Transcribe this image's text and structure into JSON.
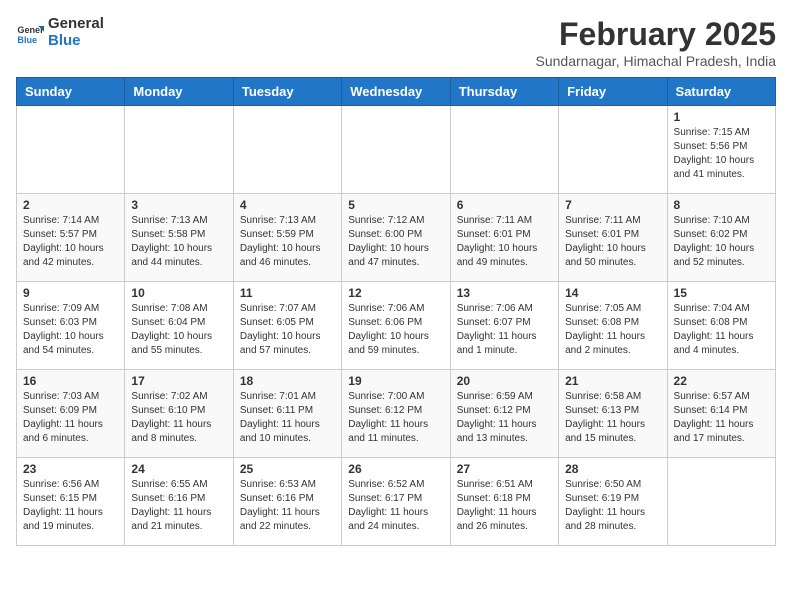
{
  "header": {
    "logo_line1": "General",
    "logo_line2": "Blue",
    "month_year": "February 2025",
    "location": "Sundarnagar, Himachal Pradesh, India"
  },
  "weekdays": [
    "Sunday",
    "Monday",
    "Tuesday",
    "Wednesday",
    "Thursday",
    "Friday",
    "Saturday"
  ],
  "weeks": [
    [
      {
        "day": "",
        "info": ""
      },
      {
        "day": "",
        "info": ""
      },
      {
        "day": "",
        "info": ""
      },
      {
        "day": "",
        "info": ""
      },
      {
        "day": "",
        "info": ""
      },
      {
        "day": "",
        "info": ""
      },
      {
        "day": "1",
        "info": "Sunrise: 7:15 AM\nSunset: 5:56 PM\nDaylight: 10 hours\nand 41 minutes."
      }
    ],
    [
      {
        "day": "2",
        "info": "Sunrise: 7:14 AM\nSunset: 5:57 PM\nDaylight: 10 hours\nand 42 minutes."
      },
      {
        "day": "3",
        "info": "Sunrise: 7:13 AM\nSunset: 5:58 PM\nDaylight: 10 hours\nand 44 minutes."
      },
      {
        "day": "4",
        "info": "Sunrise: 7:13 AM\nSunset: 5:59 PM\nDaylight: 10 hours\nand 46 minutes."
      },
      {
        "day": "5",
        "info": "Sunrise: 7:12 AM\nSunset: 6:00 PM\nDaylight: 10 hours\nand 47 minutes."
      },
      {
        "day": "6",
        "info": "Sunrise: 7:11 AM\nSunset: 6:01 PM\nDaylight: 10 hours\nand 49 minutes."
      },
      {
        "day": "7",
        "info": "Sunrise: 7:11 AM\nSunset: 6:01 PM\nDaylight: 10 hours\nand 50 minutes."
      },
      {
        "day": "8",
        "info": "Sunrise: 7:10 AM\nSunset: 6:02 PM\nDaylight: 10 hours\nand 52 minutes."
      }
    ],
    [
      {
        "day": "9",
        "info": "Sunrise: 7:09 AM\nSunset: 6:03 PM\nDaylight: 10 hours\nand 54 minutes."
      },
      {
        "day": "10",
        "info": "Sunrise: 7:08 AM\nSunset: 6:04 PM\nDaylight: 10 hours\nand 55 minutes."
      },
      {
        "day": "11",
        "info": "Sunrise: 7:07 AM\nSunset: 6:05 PM\nDaylight: 10 hours\nand 57 minutes."
      },
      {
        "day": "12",
        "info": "Sunrise: 7:06 AM\nSunset: 6:06 PM\nDaylight: 10 hours\nand 59 minutes."
      },
      {
        "day": "13",
        "info": "Sunrise: 7:06 AM\nSunset: 6:07 PM\nDaylight: 11 hours\nand 1 minute."
      },
      {
        "day": "14",
        "info": "Sunrise: 7:05 AM\nSunset: 6:08 PM\nDaylight: 11 hours\nand 2 minutes."
      },
      {
        "day": "15",
        "info": "Sunrise: 7:04 AM\nSunset: 6:08 PM\nDaylight: 11 hours\nand 4 minutes."
      }
    ],
    [
      {
        "day": "16",
        "info": "Sunrise: 7:03 AM\nSunset: 6:09 PM\nDaylight: 11 hours\nand 6 minutes."
      },
      {
        "day": "17",
        "info": "Sunrise: 7:02 AM\nSunset: 6:10 PM\nDaylight: 11 hours\nand 8 minutes."
      },
      {
        "day": "18",
        "info": "Sunrise: 7:01 AM\nSunset: 6:11 PM\nDaylight: 11 hours\nand 10 minutes."
      },
      {
        "day": "19",
        "info": "Sunrise: 7:00 AM\nSunset: 6:12 PM\nDaylight: 11 hours\nand 11 minutes."
      },
      {
        "day": "20",
        "info": "Sunrise: 6:59 AM\nSunset: 6:12 PM\nDaylight: 11 hours\nand 13 minutes."
      },
      {
        "day": "21",
        "info": "Sunrise: 6:58 AM\nSunset: 6:13 PM\nDaylight: 11 hours\nand 15 minutes."
      },
      {
        "day": "22",
        "info": "Sunrise: 6:57 AM\nSunset: 6:14 PM\nDaylight: 11 hours\nand 17 minutes."
      }
    ],
    [
      {
        "day": "23",
        "info": "Sunrise: 6:56 AM\nSunset: 6:15 PM\nDaylight: 11 hours\nand 19 minutes."
      },
      {
        "day": "24",
        "info": "Sunrise: 6:55 AM\nSunset: 6:16 PM\nDaylight: 11 hours\nand 21 minutes."
      },
      {
        "day": "25",
        "info": "Sunrise: 6:53 AM\nSunset: 6:16 PM\nDaylight: 11 hours\nand 22 minutes."
      },
      {
        "day": "26",
        "info": "Sunrise: 6:52 AM\nSunset: 6:17 PM\nDaylight: 11 hours\nand 24 minutes."
      },
      {
        "day": "27",
        "info": "Sunrise: 6:51 AM\nSunset: 6:18 PM\nDaylight: 11 hours\nand 26 minutes."
      },
      {
        "day": "28",
        "info": "Sunrise: 6:50 AM\nSunset: 6:19 PM\nDaylight: 11 hours\nand 28 minutes."
      },
      {
        "day": "",
        "info": ""
      }
    ]
  ]
}
